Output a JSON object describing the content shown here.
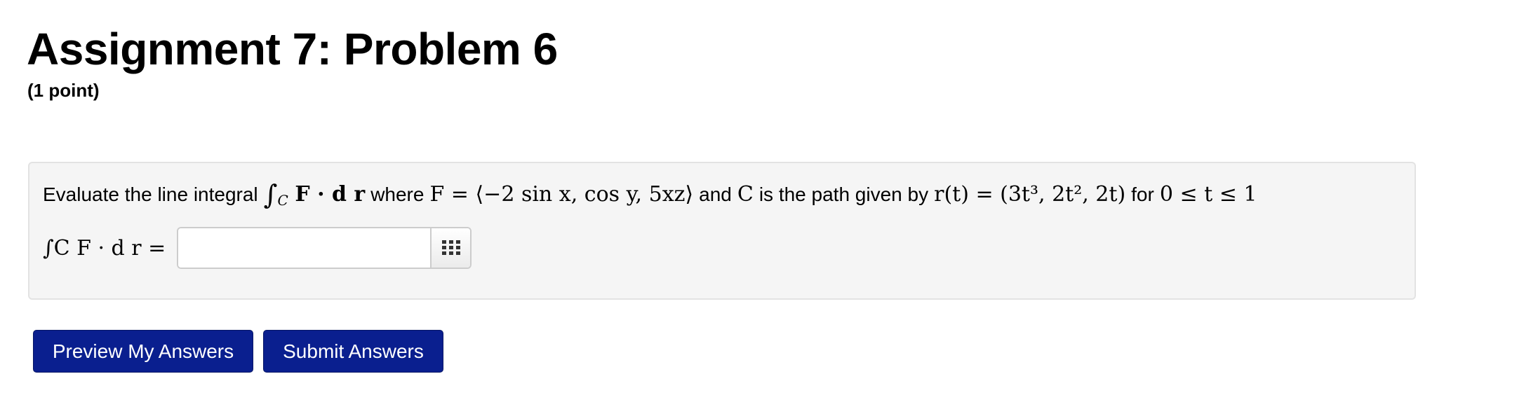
{
  "page": {
    "title": "Assignment 7: Problem 6",
    "points": "(1 point)"
  },
  "problem": {
    "text_evaluate": "Evaluate the line integral",
    "text_where": "where",
    "text_and": "and",
    "text_path": "is the path given by",
    "text_for": "for",
    "math_integral_sign": "∫",
    "math_curve_sub": "C",
    "math_integrand": "F · d r",
    "math_field": "F = ⟨−2 sin x, cos y, 5xz⟩",
    "math_curve": "C",
    "math_param": "r(t) = (3t³, 2t², 2t)",
    "math_range": "0 ≤ t ≤ 1"
  },
  "answer": {
    "lhs": "∫C F · d r =",
    "value": "",
    "placeholder": "",
    "palette_icon": "grid-icon"
  },
  "buttons": {
    "preview_label": "Preview My Answers",
    "submit_label": "Submit Answers"
  },
  "colors": {
    "button_bg": "#0a1f8f",
    "box_bg": "#f5f5f5",
    "box_border": "#e3e3e3"
  }
}
